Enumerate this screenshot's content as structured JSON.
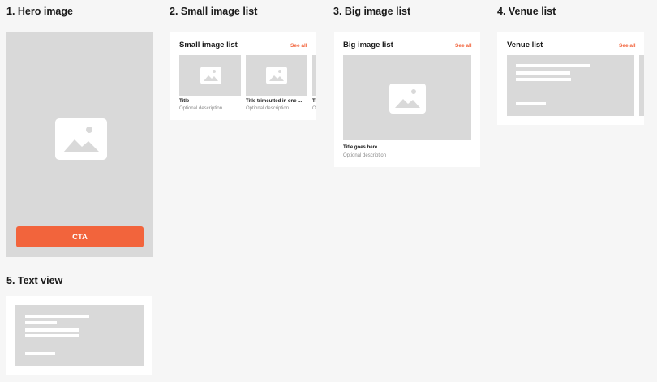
{
  "colors": {
    "accent": "#f2643c",
    "placeholder": "#d9d9d9",
    "card": "#ffffff",
    "canvas": "#f6f6f6"
  },
  "sections": {
    "hero": {
      "heading": "1. Hero image",
      "cta_label": "CTA",
      "icon": "image-icon"
    },
    "small_list": {
      "heading": "2. Small image list",
      "title": "Small image list",
      "see_all": "See all",
      "items": [
        {
          "title": "Title",
          "description": "Optional description"
        },
        {
          "title": "Title trimcutted in one ...",
          "description": "Optional description"
        },
        {
          "title": "Ti",
          "description": "Op"
        }
      ]
    },
    "big_list": {
      "heading": "3. Big image list",
      "title": "Big image list",
      "see_all": "See all",
      "item": {
        "title": "Title goes here",
        "description": "Optional description"
      }
    },
    "venue_list": {
      "heading": "4. Venue list",
      "title": "Venue list",
      "see_all": "See all"
    },
    "text_view": {
      "heading": "5. Text view"
    }
  }
}
